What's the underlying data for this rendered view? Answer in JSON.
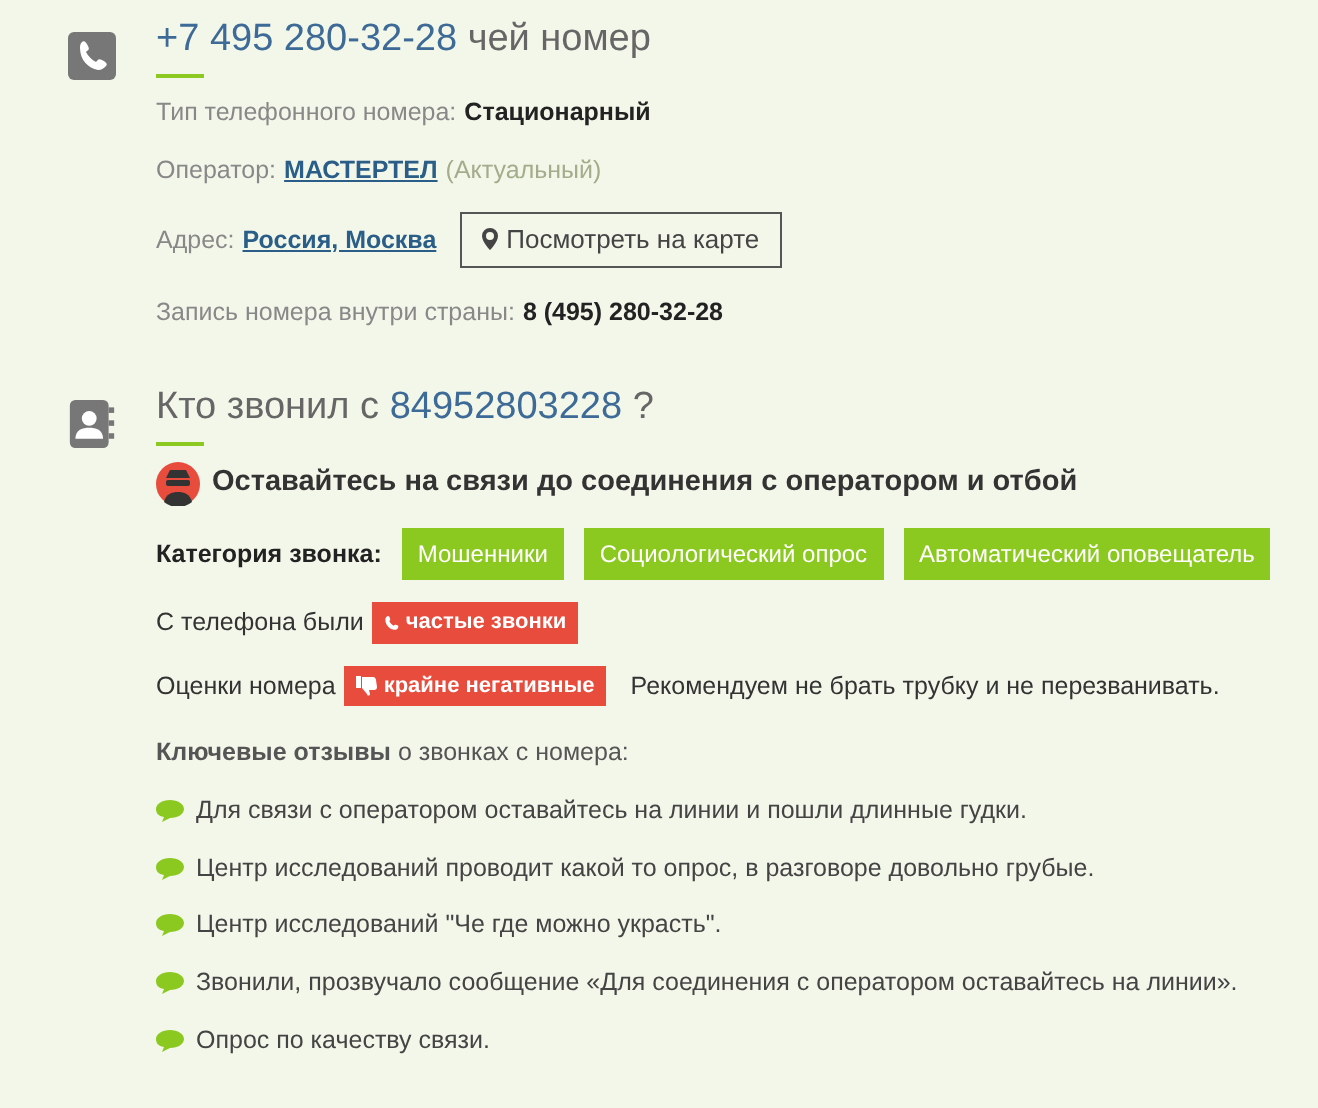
{
  "number_section": {
    "number": "+7 495 280-32-28",
    "title_suffix": "чей номер",
    "rows": [
      {
        "kind": "text",
        "label": "Тип телефонного номера:",
        "value": "Стационарный"
      },
      {
        "kind": "link",
        "label": "Оператор:",
        "value": "МАСТЕРТЕЛ",
        "note": "(Актуальный)"
      },
      {
        "kind": "map",
        "label": "Адрес:",
        "value": "Россия, Москва",
        "button": "Посмотреть на карте"
      },
      {
        "kind": "text",
        "label": "Запись номера внутри страны:",
        "value": "8 (495) 280-32-28"
      }
    ]
  },
  "caller_section": {
    "title_prefix": "Кто звонил с",
    "number": "84952803228",
    "title_suffix": "?",
    "verdict": "Оставайтесь на связи до соединения с оператором и отбой",
    "category_label": "Категория звонка:",
    "categories": [
      "Мошенники",
      "Социологический опрос",
      "Автоматический оповещатель"
    ],
    "frequency_label": "С телефона были",
    "frequency_badge": "частые звонки",
    "rating_label": "Оценки номера",
    "rating_badge": "крайне негативные",
    "rating_advice": "Рекомендуем не брать трубку и не перезванивать.",
    "reviews_heading": "**Ключевые отзывы** о звонках с номера:",
    "reviews": [
      "Для связи с оператором оставайтесь на линии и пошли длинные гудки.",
      "Центр исследований проводит какой то опрос, в разговоре довольно грубые.",
      "Центр исследований \"Че где можно украсть\".",
      "Звонили, прозвучало сообщение «Для соединения с оператором оставайтесь на линии».",
      "Опрос по качеству связи."
    ]
  }
}
